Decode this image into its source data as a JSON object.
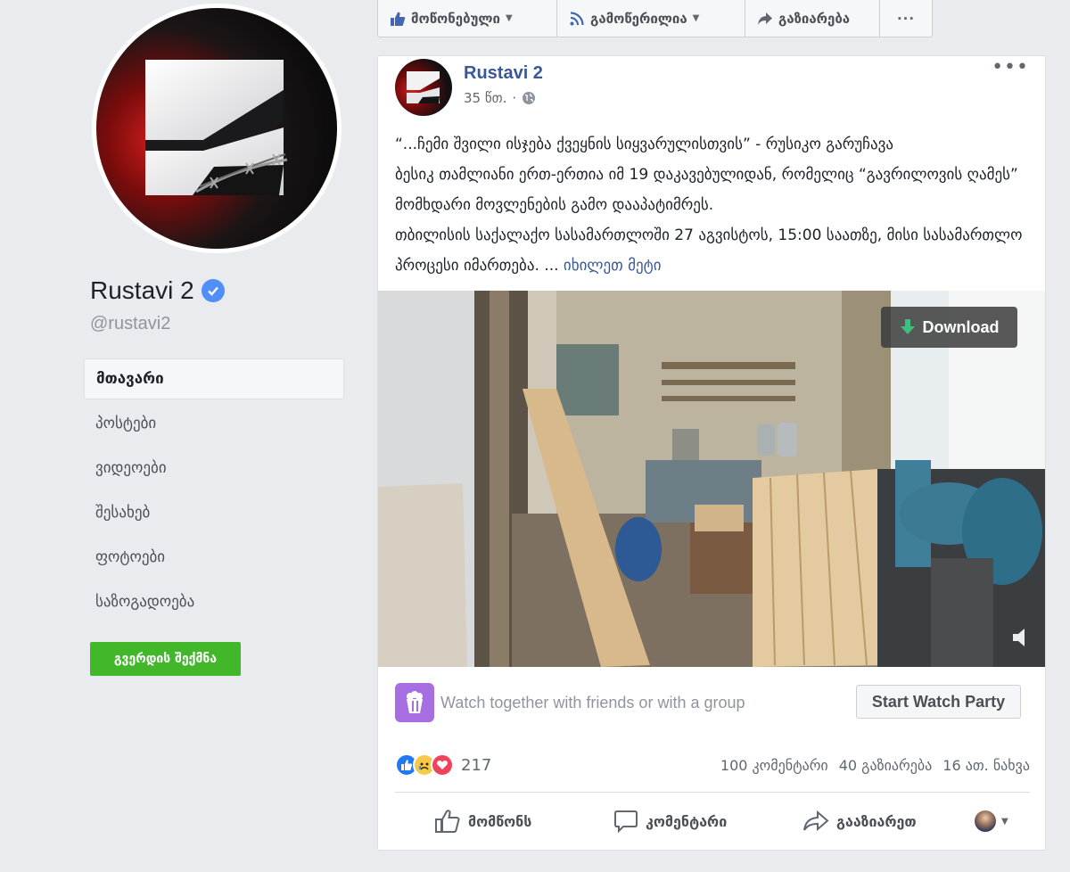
{
  "sidebar": {
    "page_name": "Rustavi 2",
    "handle": "@rustavi2",
    "nav": [
      {
        "label": "მთავარი",
        "active": true
      },
      {
        "label": "პოსტები",
        "active": false
      },
      {
        "label": "ვიდეოები",
        "active": false
      },
      {
        "label": "შესახებ",
        "active": false
      },
      {
        "label": "ფოტოები",
        "active": false
      },
      {
        "label": "საზოგადოება",
        "active": false
      }
    ],
    "create_page_label": "გვერდის შექმნა"
  },
  "top_actions": {
    "liked_label": "მოწონებული",
    "following_label": "გამოწერილია",
    "share_label": "გაზიარება",
    "more_label": "···"
  },
  "post": {
    "author": "Rustavi 2",
    "time": "35 წთ.",
    "menu": "•••",
    "title_line": "“...ჩემი შვილი ისჯება ქვეყნის სიყვარულისთვის” - რუსიკო გარუჩავა",
    "paragraph_1": "ბესიკ თამლიანი ერთ-ერთია იმ 19 დაკავებულიდან, რომელიც “გავრილოვის ღამეს” მომხდარი მოვლენების გამო დააპატიმრეს.",
    "paragraph_2": "თბილისის საქალაქო სასამართლოში 27 აგვისტოს, 15:00 საათზე, მისი სასამართლო პროცესი იმართება. ...",
    "see_more": "იხილეთ მეტი",
    "download_label": "Download",
    "watch_together_text": "Watch together with friends or with a group",
    "watch_party_label": "Start Watch Party",
    "reaction_count": "217",
    "comments": "100 კომენტარი",
    "shares": "40 გაზიარება",
    "views": "16 ათ. ნახვა",
    "like_label": "მომწონს",
    "comment_label": "კომენტარი",
    "share_label": "გააზიარეთ"
  },
  "colors": {
    "link_blue": "#385898",
    "green_button": "#42b72a",
    "verified_blue": "#4f8ff7",
    "watch_purple": "#a66ee0"
  },
  "icons": [
    "thumbs-up-icon",
    "rss-icon",
    "share-arrow-icon",
    "verified-badge-icon",
    "globe-icon",
    "download-icon",
    "speaker-icon",
    "popcorn-icon",
    "like-reaction-icon",
    "sad-reaction-icon",
    "love-reaction-icon",
    "comment-icon"
  ]
}
